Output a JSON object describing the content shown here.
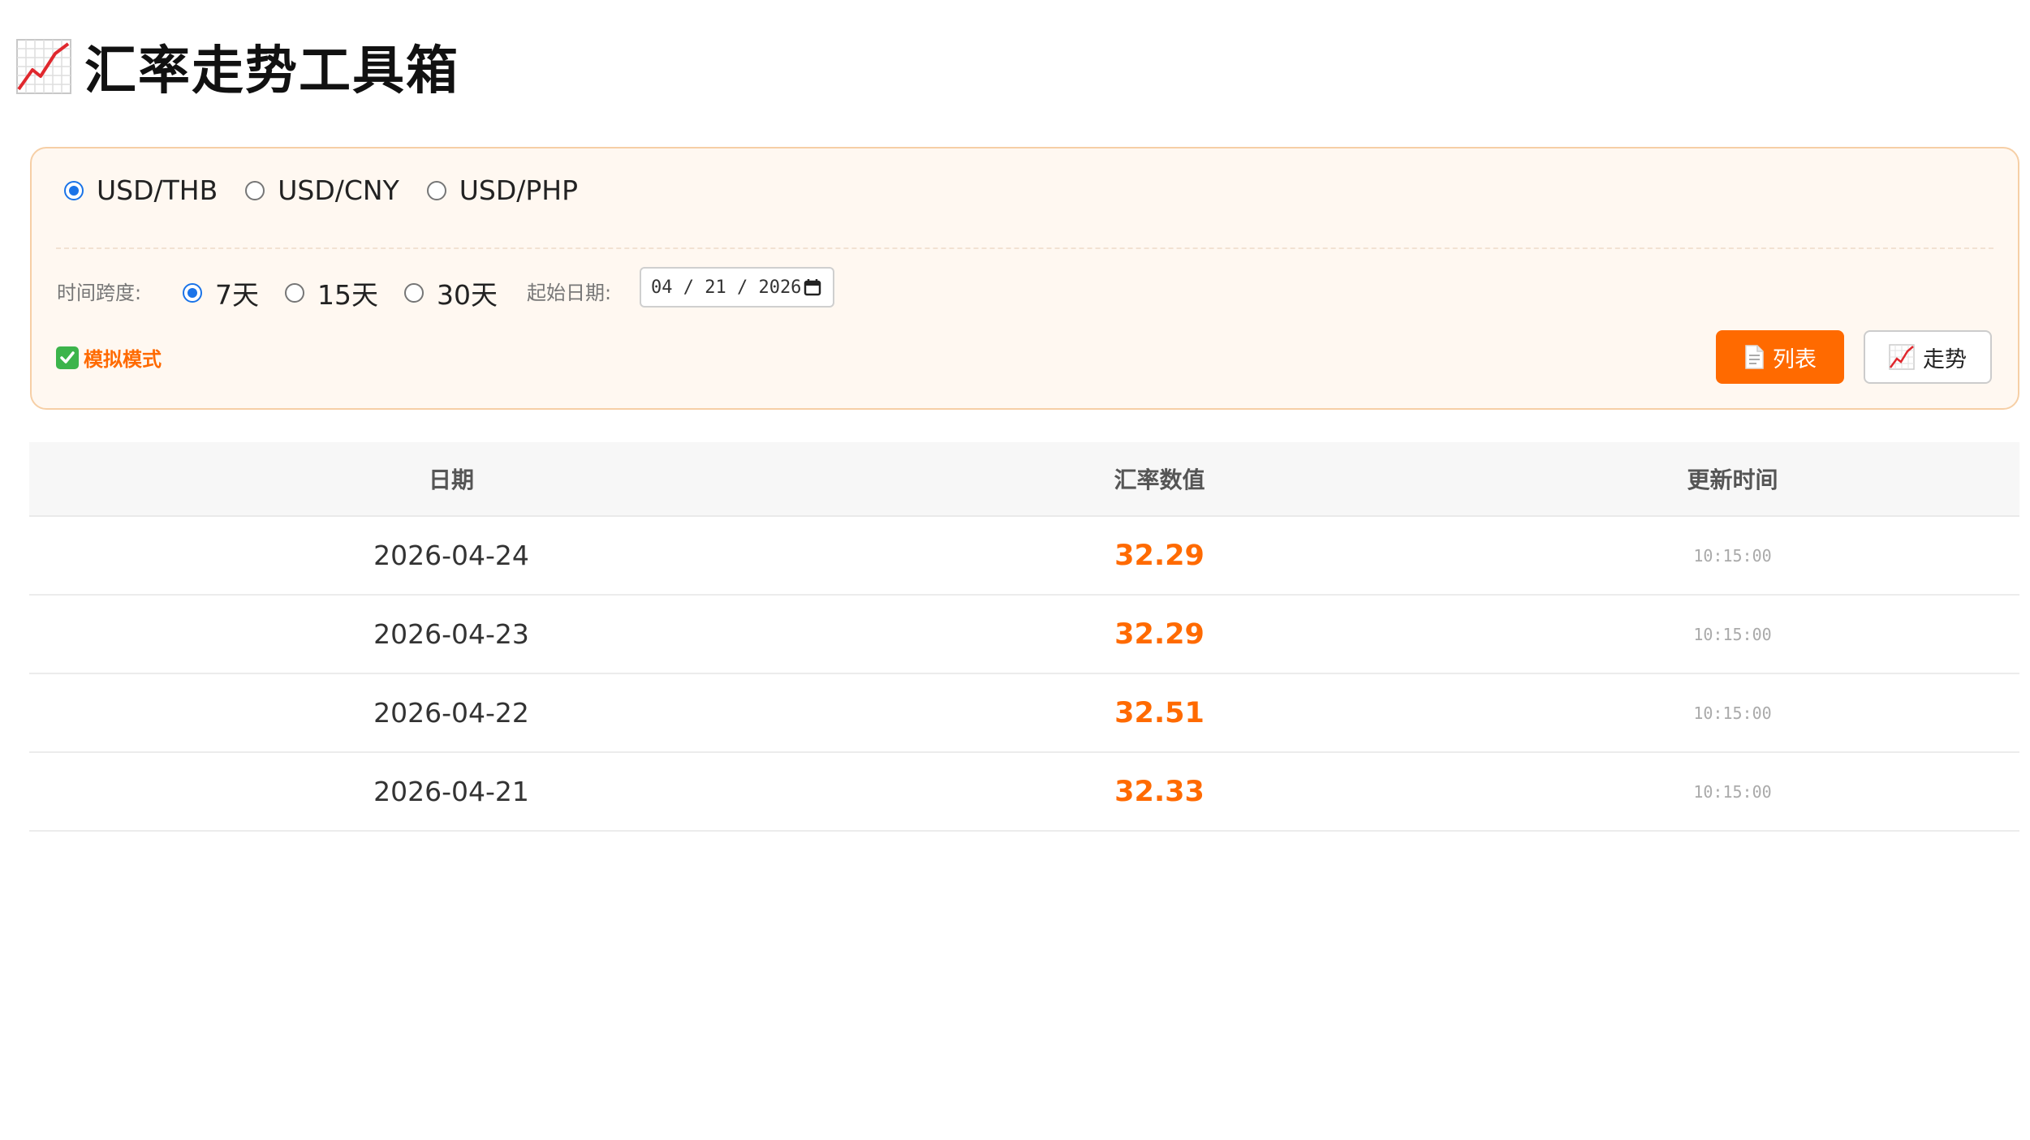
{
  "app": {
    "title": "汇率走势工具箱"
  },
  "currency_pairs": [
    {
      "label": "USD/THB",
      "checked": true
    },
    {
      "label": "USD/CNY",
      "checked": false
    },
    {
      "label": "USD/PHP",
      "checked": false
    }
  ],
  "range": {
    "label": "时间跨度:",
    "options": [
      {
        "label": "7天",
        "checked": true
      },
      {
        "label": "15天",
        "checked": false
      },
      {
        "label": "30天",
        "checked": false
      }
    ]
  },
  "start_date": {
    "label": "起始日期:",
    "value": "04 / 21 / 2026"
  },
  "mode": {
    "label": "模拟模式"
  },
  "buttons": {
    "list": "列表",
    "trend": "走势"
  },
  "table": {
    "headers": [
      "日期",
      "汇率数值",
      "更新时间"
    ],
    "rows": [
      {
        "date": "2026-04-24",
        "rate": "32.29",
        "time": "10:15:00"
      },
      {
        "date": "2026-04-23",
        "rate": "32.29",
        "time": "10:15:00"
      },
      {
        "date": "2026-04-22",
        "rate": "32.51",
        "time": "10:15:00"
      },
      {
        "date": "2026-04-21",
        "rate": "32.33",
        "time": "10:15:00"
      }
    ]
  },
  "colors": {
    "accent": "#ff6a00",
    "panel_bg": "#fff8f1",
    "panel_border": "#f6cfa6",
    "radio": "#1a73e8"
  }
}
